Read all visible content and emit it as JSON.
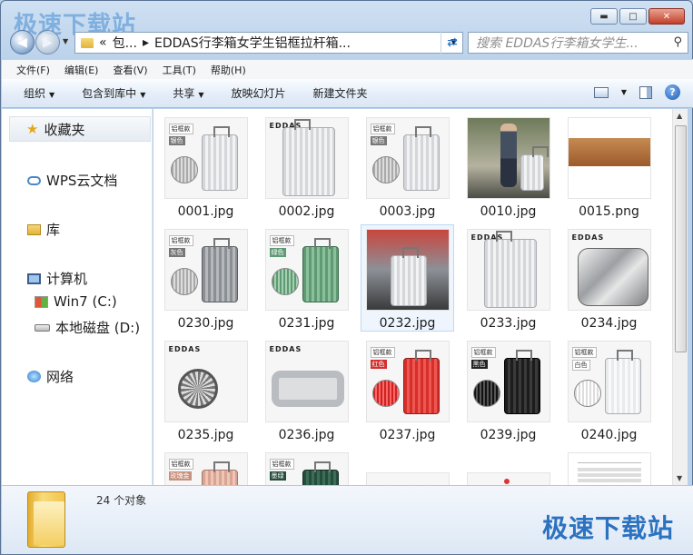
{
  "watermark": "极速下载站",
  "window": {
    "caption_buttons": {
      "minimize": "▬",
      "maximize": "□",
      "close": "✕"
    }
  },
  "nav": {
    "back_glyph": "◀",
    "forward_glyph": "▶",
    "address": {
      "crumb1": "«",
      "crumb2": "包...",
      "sep": "▸",
      "current": "EDDAS行李箱女学生铝框拉杆箱..."
    },
    "search_placeholder": "搜索 EDDAS行李箱女学生..."
  },
  "menu": [
    "文件(F)",
    "编辑(E)",
    "查看(V)",
    "工具(T)",
    "帮助(H)"
  ],
  "toolbar": {
    "organize": "组织",
    "include_in_library": "包含到库中",
    "share": "共享",
    "slideshow": "放映幻灯片",
    "new_folder": "新建文件夹",
    "help": "?"
  },
  "sidebar": {
    "favorites": "收藏夹",
    "wps_cloud": "WPS云文档",
    "libraries": "库",
    "computer": "计算机",
    "drive_c": "Win7 (C:)",
    "drive_d": "本地磁盘 (D:)",
    "network": "网络"
  },
  "files": [
    {
      "name": "0001.jpg",
      "tag1": "铝框款",
      "tag2": "银色",
      "tag3": "拉丝防刮"
    },
    {
      "name": "0002.jpg",
      "brand": "EDDAS"
    },
    {
      "name": "0003.jpg",
      "tag1": "铝框款",
      "tag2": "银色",
      "tag3": "拉丝防刮"
    },
    {
      "name": "0010.jpg"
    },
    {
      "name": "0015.png"
    },
    {
      "name": "0230.jpg",
      "tag1": "铝框款",
      "tag2": "灰色",
      "tag3": "拉丝防刮"
    },
    {
      "name": "0231.jpg",
      "tag1": "铝框款",
      "tag2": "绿色",
      "tag3": "拉丝防刮"
    },
    {
      "name": "0232.jpg"
    },
    {
      "name": "0233.jpg",
      "brand": "EDDAS"
    },
    {
      "name": "0234.jpg",
      "brand": "EDDAS"
    },
    {
      "name": "0235.jpg",
      "brand": "EDDAS"
    },
    {
      "name": "0236.jpg",
      "brand": "EDDAS"
    },
    {
      "name": "0237.jpg",
      "tag1": "铝框款",
      "tag2": "红色",
      "tag3": "拉丝防刮"
    },
    {
      "name": "0239.jpg",
      "tag1": "铝框款",
      "tag2": "黑色",
      "tag3": "拉丝防刮"
    },
    {
      "name": "0240.jpg",
      "tag1": "铝框款",
      "tag2": "白色",
      "tag3": "拉丝防刮"
    },
    {
      "name": "",
      "tag1": "铝框款",
      "tag2": "玫瑰金"
    },
    {
      "name": "",
      "tag1": "铝框款",
      "tag2": "墨绿"
    },
    {
      "name": ""
    },
    {
      "name": ""
    },
    {
      "name": ""
    }
  ],
  "status": {
    "count": "24 个对象"
  }
}
